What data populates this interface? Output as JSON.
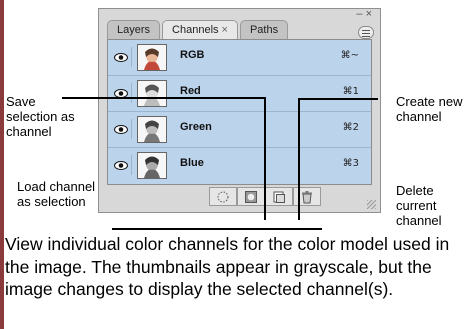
{
  "tabs": [
    {
      "label": "Layers",
      "active": false
    },
    {
      "label": "Channels",
      "active": true,
      "close": "×"
    },
    {
      "label": "Paths",
      "active": false
    }
  ],
  "window_controls": "– ×",
  "channels": [
    {
      "name": "RGB",
      "shortcut": "⌘~"
    },
    {
      "name": "Red",
      "shortcut": "⌘1"
    },
    {
      "name": "Green",
      "shortcut": "⌘2"
    },
    {
      "name": "Blue",
      "shortcut": "⌘3"
    }
  ],
  "icons": {
    "eye": "eye-icon",
    "load": "dotted-circle-icon",
    "save": "mask-icon",
    "new": "new-channel-icon",
    "delete": "trash-icon"
  },
  "callouts": {
    "save_selection": "Save selection as channel",
    "load_channel": "Load channel as selection",
    "create_new": "Create new channel",
    "delete_current": "Delete current channel"
  },
  "caption": "View individual color channels for the color model used in the image. The thumbnails appear in grayscale, but the image changes to display the selected channel(s).",
  "colors": {
    "list_bg": "#bcd3ec",
    "panel_bg": "#d8d8d8"
  }
}
